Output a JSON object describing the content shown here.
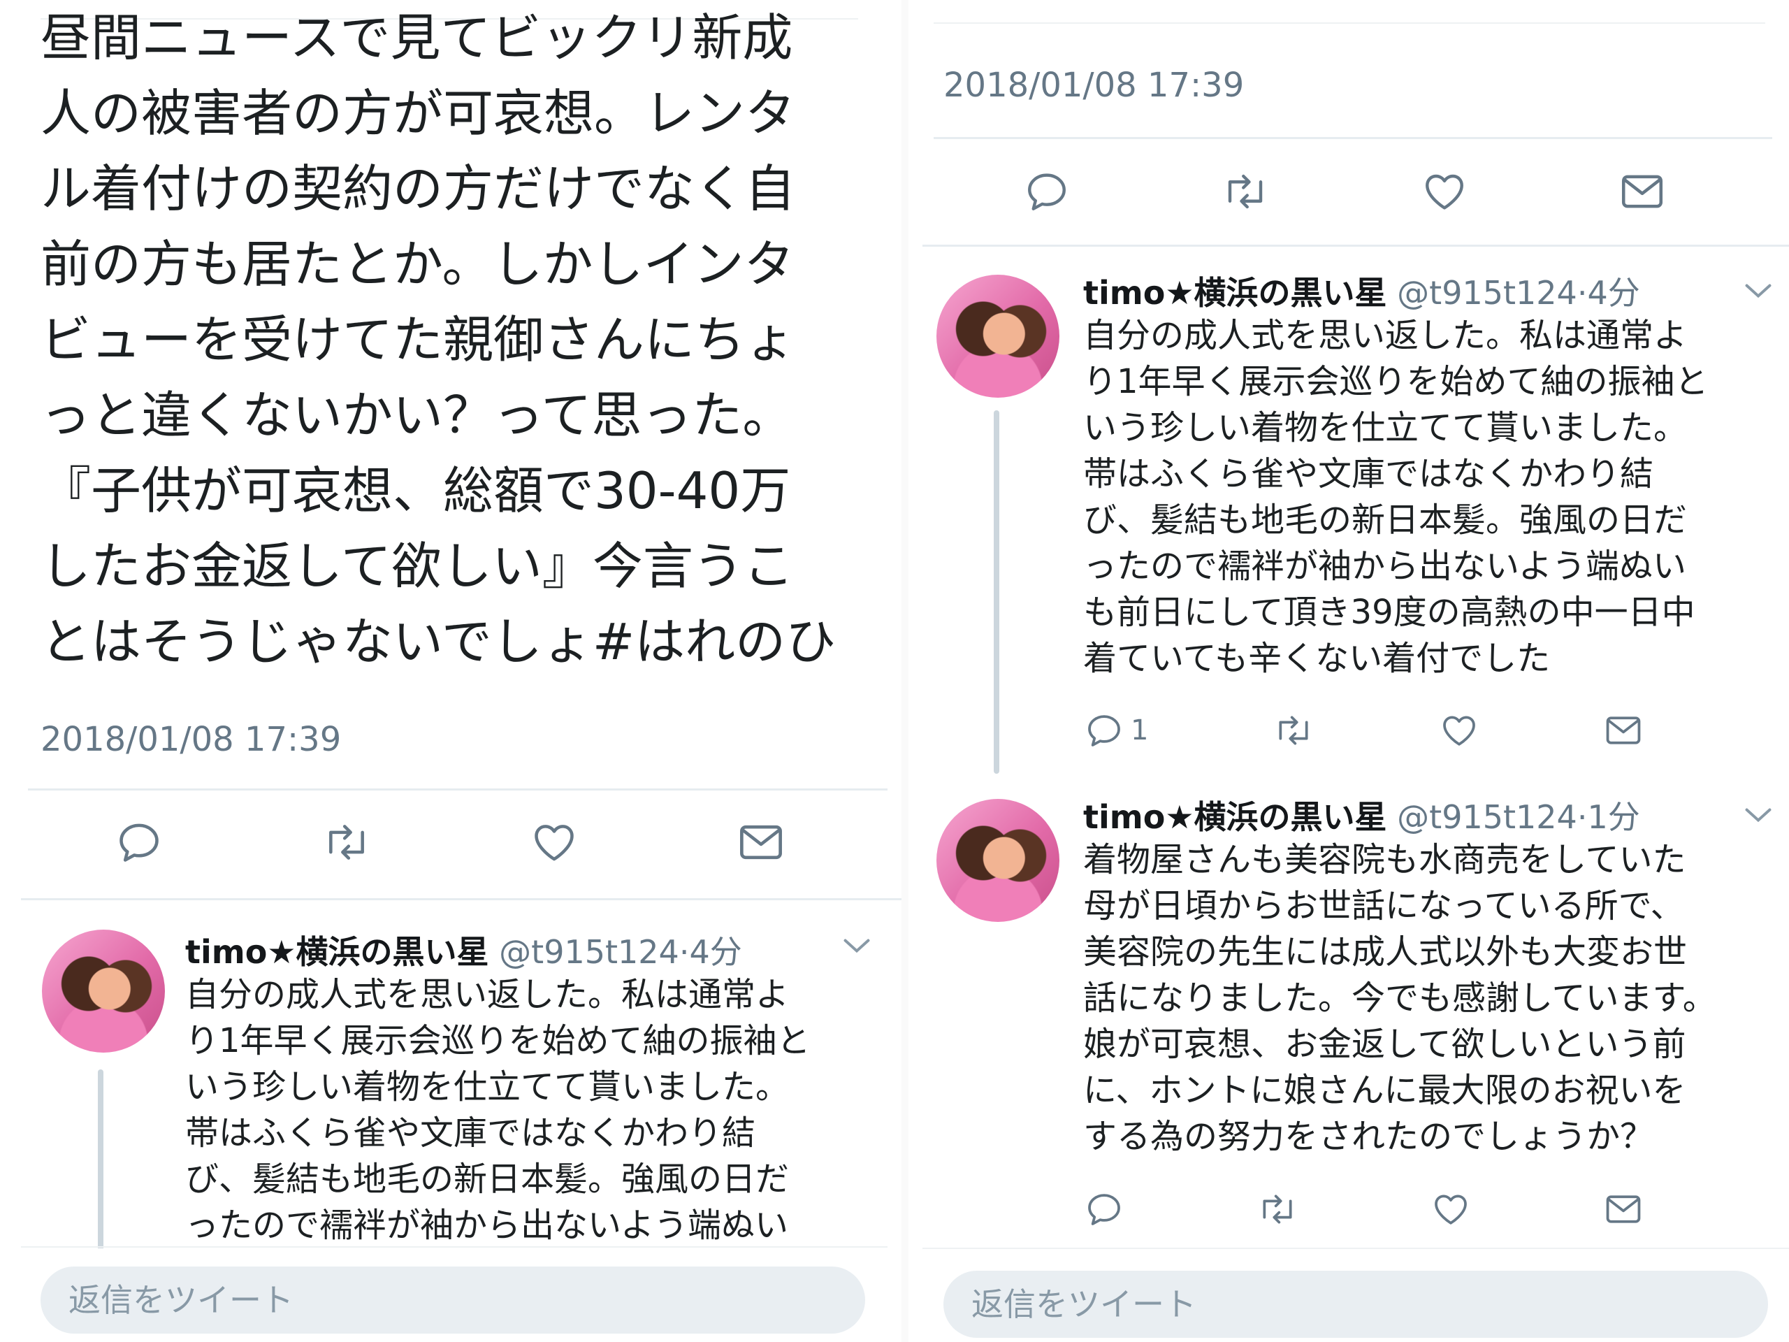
{
  "main_tweet": {
    "text_lines": [
      "昼間ニュースで見てビックリ新成",
      "人の被害者の方が可哀想。レンタ",
      "ル着付けの契約の方だけでなく自",
      "前の方も居たとか。しかしインタ",
      "ビューを受けてた親御さんにちょ",
      "っと違くないかい？って思った。",
      "『子供が可哀想、総額で30-40万",
      "したお金返して欲しい』今言うこ",
      "とはそうじゃないでしょ#はれのひ"
    ],
    "timestamp": "2018/01/08 17:39"
  },
  "reply_1": {
    "name": "timo★横浜の黒い星",
    "handle": "@t915t124",
    "time": "4分",
    "text_lines": [
      "自分の成人式を思い返した。私は通常よ",
      "り1年早く展示会巡りを始めて紬の振袖と",
      "いう珍しい着物を仕立てて貰いました。",
      "帯はふくら雀や文庫ではなくかわり結",
      "び、髪結も地毛の新日本髪。強風の日だ",
      "ったので襦袢が袖から出ないよう端ぬい",
      "も前日にして頂き39度の高熱の中一日中",
      "着ていても辛くない着付でした"
    ],
    "reply_count": "1"
  },
  "reply_2": {
    "name": "timo★横浜の黒い星",
    "handle": "@t915t124",
    "time": "1分",
    "text_lines": [
      "着物屋さんも美容院も水商売をしていた",
      "母が日頃からお世話になっている所で、",
      "美容院の先生には成人式以外も大変お世",
      "話になりました。今でも感謝しています。",
      "娘が可哀想、お金返して欲しいという前",
      "に、ホントに娘さんに最大限のお祝いを",
      "する為の努力をされたのでしょうか？"
    ]
  },
  "separator": "·",
  "reply_placeholder": "返信をツイート",
  "icons": [
    "reply-icon",
    "retweet-icon",
    "like-icon",
    "message-icon",
    "chevron-down-icon"
  ],
  "colors": {
    "meta_gray": "#657786",
    "divider": "#e6ecf0",
    "reply_box": "#e9eef2"
  }
}
